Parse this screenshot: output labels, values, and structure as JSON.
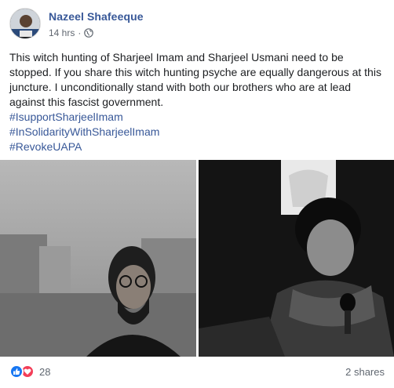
{
  "post": {
    "author": "Nazeel Shafeeque",
    "timestamp": "14 hrs",
    "separator": "·",
    "privacy_icon": "globe-icon",
    "body": "This witch hunting of Sharjeel Imam and Sharjeel Usmani need to be stopped. If you share this witch hunting psyche are equally dangerous at this juncture. I unconditionally stand with both our brothers who are at lead against this fascist government.",
    "hashtags": [
      "#IsupportSharjeelImam",
      "#InSolidarityWithSharjeelImam",
      "#RevokeUAPA"
    ]
  },
  "footer": {
    "reaction_icons": [
      "like-icon",
      "love-icon"
    ],
    "reaction_count": "28",
    "shares": "2 shares"
  },
  "colors": {
    "author": "#385898",
    "hashtag": "#385898",
    "like": "#1877f2",
    "love": "#f33e58",
    "meta": "#606770"
  }
}
